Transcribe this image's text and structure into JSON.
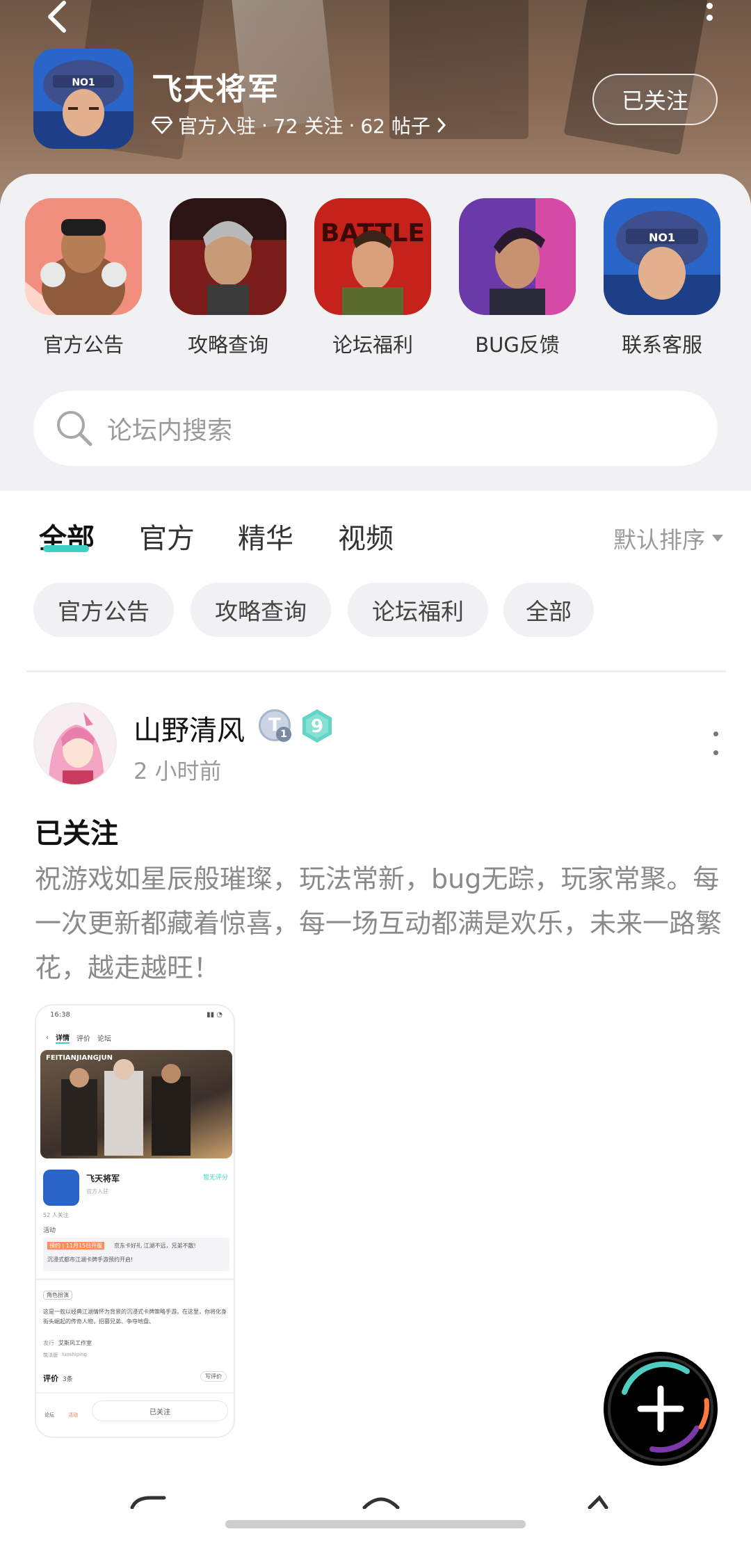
{
  "header": {
    "title": "飞天将军",
    "official_tag": "官方入驻",
    "follow_count": "72 关注",
    "post_count": "62 帖子",
    "follow_button": "已关注"
  },
  "shortcuts": [
    {
      "label": "官方公告"
    },
    {
      "label": "攻略查询"
    },
    {
      "label": "论坛福利"
    },
    {
      "label": "BUG反馈"
    },
    {
      "label": "联系客服"
    }
  ],
  "search": {
    "placeholder": "论坛内搜索"
  },
  "tabs": [
    {
      "label": "全部",
      "active": true
    },
    {
      "label": "官方",
      "active": false
    },
    {
      "label": "精华",
      "active": false
    },
    {
      "label": "视频",
      "active": false
    }
  ],
  "sort": {
    "label": "默认排序"
  },
  "chips": [
    "官方公告",
    "攻略查询",
    "论坛福利",
    "全部"
  ],
  "post": {
    "username": "山野清风",
    "level": "9",
    "timestamp": "2 小时前",
    "title": "已关注",
    "body": "祝游戏如星辰般璀璨，玩法常新，bug无踪，玩家常聚。每一次更新都藏着惊喜，每一场互动都满是欢乐，未来一路繁花，越走越旺！",
    "screenshot": {
      "time": "16:38",
      "tab_detail": "详情",
      "tab_review": "评价",
      "tab_forum": "论坛",
      "banner_text": "FEITIANJIANGJUN",
      "game_name": "飞天将军",
      "rating_text": "暂无评分",
      "official": "官方入驻",
      "followers": "52 人关注",
      "activity": "活动",
      "promo_tag": "预约 | 11月15日开服",
      "promo_text": "京东卡好礼 江湖不远，兄弟不散!",
      "promo_text2": "沉浸式都市江湖卡牌手游预约开启!",
      "role_tag": "角色扮演",
      "desc": "这是一款以经典江湖情怀为背景的沉浸式卡牌策略手游。在这里，你将化身街头崛起的传奇人物，招募兄弟、争夺地盘、",
      "developer_label": "发行",
      "developer": "艾斯风工作室",
      "pkg_label": "筑法版",
      "pkg": "luoshiping",
      "review_label": "评价",
      "review_count": "3条",
      "write_review": "写评价",
      "nav_forum": "论坛",
      "nav_activity": "活动",
      "followed": "已关注"
    }
  },
  "colors": {
    "accent": "#3fd0c4",
    "level_badge": "#5fd6c6",
    "chip_bg": "#f1f1f3",
    "muted_text": "#9a9a9a"
  },
  "icons": [
    "back-arrow-icon",
    "more-icon",
    "diamond-icon",
    "chevron-right-icon",
    "search-icon",
    "plus-icon"
  ]
}
